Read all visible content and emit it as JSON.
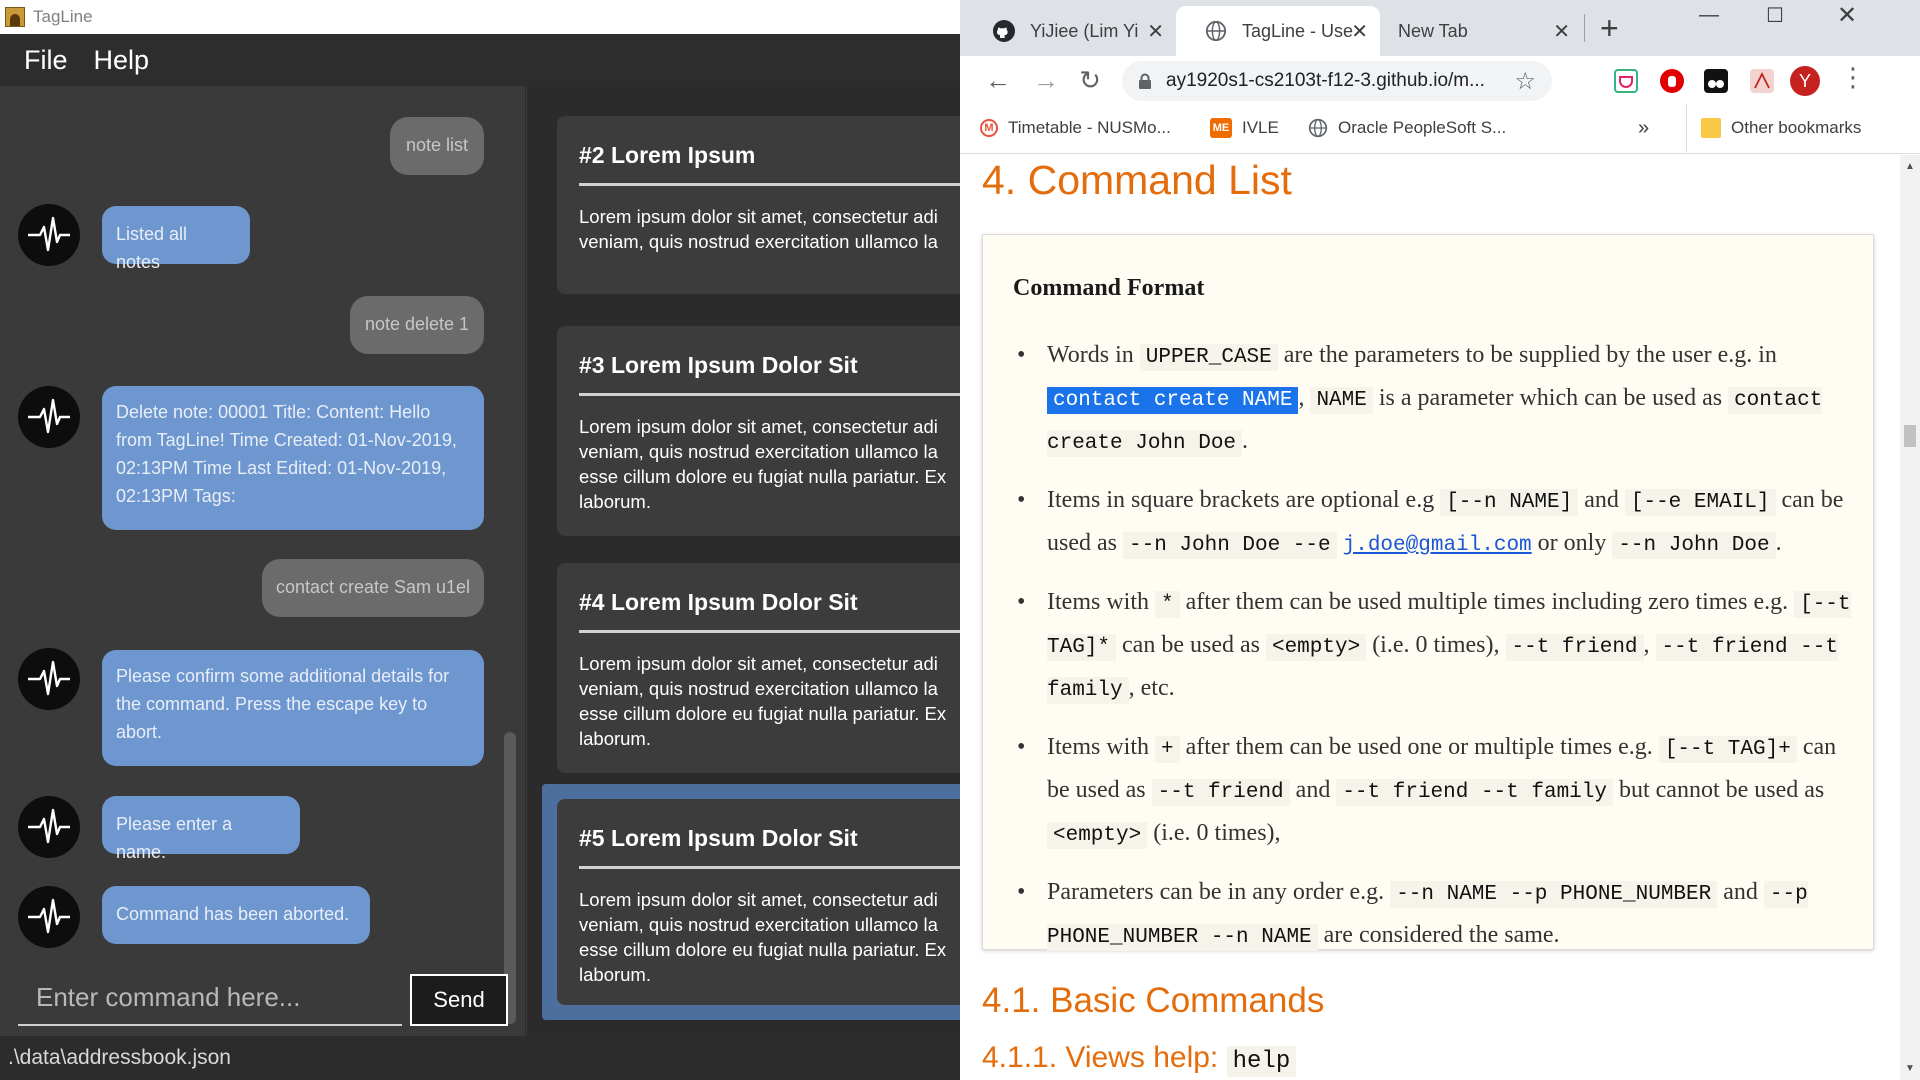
{
  "app": {
    "title": "TagLine",
    "menu": [
      "File",
      "Help"
    ],
    "chat": [
      {
        "role": "user",
        "text": "note list"
      },
      {
        "role": "bot",
        "text": "Listed all notes"
      },
      {
        "role": "user",
        "text": "note delete 1"
      },
      {
        "role": "bot",
        "text": "Delete note: 00001 Title:  Content: Hello from TagLine! Time Created: 01-Nov-2019, 02:13PM Time Last Edited: 01-Nov-2019, 02:13PM Tags:"
      },
      {
        "role": "user",
        "text": "contact create Sam u1el"
      },
      {
        "role": "bot",
        "text": "Please confirm some additional details for the command. Press the escape key to abort."
      },
      {
        "role": "bot",
        "text": "Please enter a name."
      },
      {
        "role": "bot",
        "text": "Command has been aborted."
      }
    ],
    "input_placeholder": "Enter command here...",
    "send_label": "Send",
    "status_path": ".\\data\\addressbook.json",
    "notes": [
      {
        "title": "#2  Lorem Ipsum",
        "body": [
          "Lorem ipsum dolor sit amet, consectetur adi",
          "veniam, quis nostrud exercitation ullamco la"
        ]
      },
      {
        "title": "#3  Lorem Ipsum Dolor Sit",
        "body": [
          "Lorem ipsum dolor sit amet, consectetur adi",
          "veniam, quis nostrud exercitation ullamco la",
          "esse cillum dolore eu fugiat nulla pariatur. Ex",
          "laborum."
        ]
      },
      {
        "title": "#4  Lorem Ipsum Dolor Sit",
        "body": [
          "Lorem ipsum dolor sit amet, consectetur adi",
          "veniam, quis nostrud exercitation ullamco la",
          "esse cillum dolore eu fugiat nulla pariatur. Ex",
          "laborum."
        ]
      },
      {
        "title": "#5  Lorem Ipsum Dolor Sit",
        "body": [
          "Lorem ipsum dolor sit amet, consectetur adi",
          "veniam, quis nostrud exercitation ullamco la",
          "esse cillum dolore eu fugiat nulla pariatur. Ex",
          "laborum."
        ]
      }
    ],
    "selected_note_index": 3
  },
  "browser": {
    "tabs": [
      {
        "label": "YiJiee (Lim Yi",
        "icon": "github-icon",
        "active": false
      },
      {
        "label": "TagLine - Use",
        "icon": "globe-icon",
        "active": true
      },
      {
        "label": "New Tab",
        "icon": "",
        "active": false
      }
    ],
    "url": "ay1920s1-cs2103t-f12-3.github.io/m...",
    "bookmarks": [
      {
        "label": "Timetable - NUSMo...",
        "icon": "nusmods-icon"
      },
      {
        "label": "IVLE",
        "icon": "ivle-icon"
      },
      {
        "label": "Oracle PeopleSoft S...",
        "icon": "globe-icon"
      }
    ],
    "bookmarks_overflow": "»",
    "other_bookmarks": "Other bookmarks",
    "profile_initial": "Y",
    "accent_color": "#e46c0a"
  },
  "doc": {
    "h_command_list": "4. Command List",
    "box_title": "Command Format",
    "b1": {
      "t1": "Words in",
      "c1": "UPPER_CASE",
      "t2": "are the parameters to be supplied by the user e.g. in",
      "c2": "contact create NAME",
      "t3": ",",
      "c3": "NAME",
      "t4": "is a parameter which can be used as",
      "c4": "contact create John Doe",
      "t5": "."
    },
    "b2": {
      "t1": "Items in square brackets are optional e.g",
      "c1": "[--n NAME]",
      "t2": "and",
      "c2": "[--e EMAIL]",
      "t3": "can be used as",
      "c3": "--n John Doe --e",
      "link": "j.doe@gmail.com",
      "t4": "or only",
      "c4": "--n John Doe",
      "t5": "."
    },
    "b3": {
      "t1": "Items with",
      "c1": "*",
      "t2": "after them can be used multiple times including zero times e.g.",
      "c2": "[--t TAG]*",
      "t3": "can be used as",
      "c3": "<empty>",
      "t4": "(i.e. 0 times),",
      "c4": "--t friend",
      "t5": ",",
      "c5": "--t friend --t family",
      "t6": ", etc."
    },
    "b4": {
      "t1": "Items with",
      "c1": "+",
      "t2": "after them can be used one or multiple times e.g.",
      "c2": "[--t TAG]+",
      "t3": "can be used as",
      "c3": "--t friend",
      "t4": "and",
      "c4": "--t friend --t family",
      "t5": "but cannot be used as",
      "c5": "<empty>",
      "t6": "(i.e. 0 times),"
    },
    "b5": {
      "t1": "Parameters can be in any order e.g.",
      "c1": "--n NAME --p PHONE_NUMBER",
      "t2": "and",
      "c2": "--p PHONE_NUMBER --n NAME",
      "t3": "are considered the same."
    },
    "h_basic": "4.1. Basic Commands",
    "h_views_help": "4.1.1. Views help:",
    "h_views_help_code": "help"
  }
}
